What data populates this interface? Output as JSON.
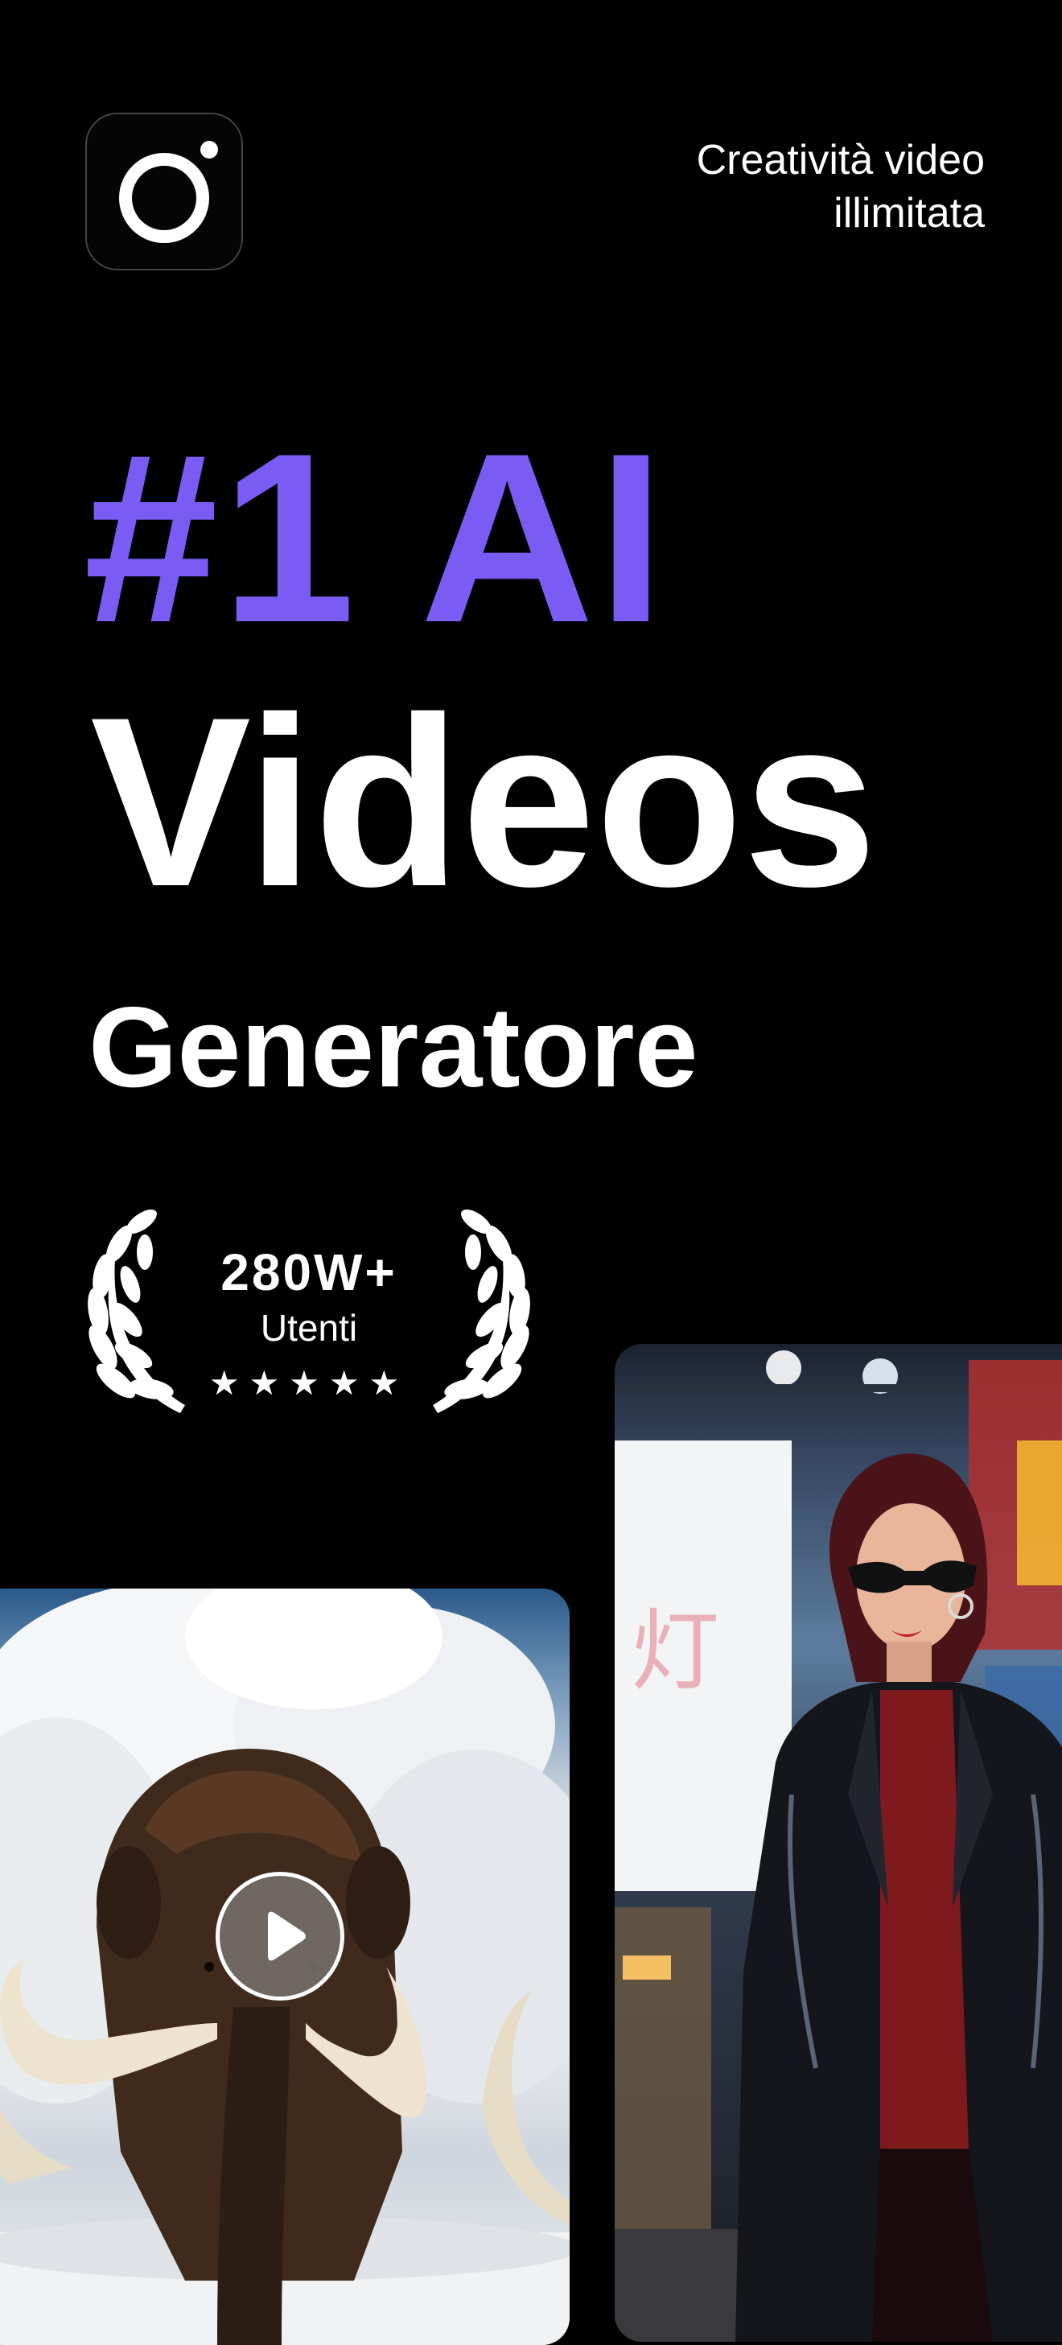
{
  "brand": {
    "accent_color": "#7a5cf5",
    "logo_icon": "app-logo-icon"
  },
  "tagline": {
    "line1": "Creatività video",
    "line2": "illimitata"
  },
  "headline": {
    "accent": "#1 AI",
    "main": "Videos",
    "sub": "Generatore"
  },
  "award": {
    "count": "280W+",
    "label": "Utenti",
    "stars": "★★★★★",
    "rating": 5,
    "icon": "laurel-wreath-icon"
  },
  "cards": [
    {
      "name": "mammoth-video-card",
      "has_play_button": true,
      "play_icon": "play-icon"
    },
    {
      "name": "city-woman-video-card",
      "has_play_button": false
    }
  ]
}
